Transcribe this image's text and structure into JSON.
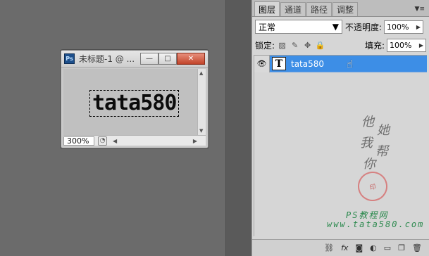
{
  "document_window": {
    "app_badge": "Ps",
    "title": "未标题-1 @ ...",
    "min_label": "—",
    "max_label": "□",
    "close_label": "✕",
    "canvas_text": "tata580",
    "zoom": "300%"
  },
  "layers_panel": {
    "tabs": [
      {
        "label": "图层",
        "active": true
      },
      {
        "label": "通道",
        "active": false
      },
      {
        "label": "路径",
        "active": false
      },
      {
        "label": "调整",
        "active": false
      }
    ],
    "blend_mode": "正常",
    "opacity_label": "不透明度:",
    "opacity_value": "100%",
    "lock_label": "锁定:",
    "fill_label": "填充:",
    "fill_value": "100%",
    "layers": [
      {
        "name": "tata580",
        "type_glyph": "T",
        "selected": true,
        "visible": true
      }
    ]
  },
  "watermark": {
    "cjk_chars": [
      "他",
      "她",
      "我",
      "帮",
      "你"
    ],
    "line1": "PS教程网",
    "line2": "www.tata580.com"
  },
  "colors": {
    "selection_blue": "#3d8ee6",
    "close_red": "#c2442a",
    "watermark_green": "#2d8a4f",
    "seal_red": "#c34b4b"
  }
}
